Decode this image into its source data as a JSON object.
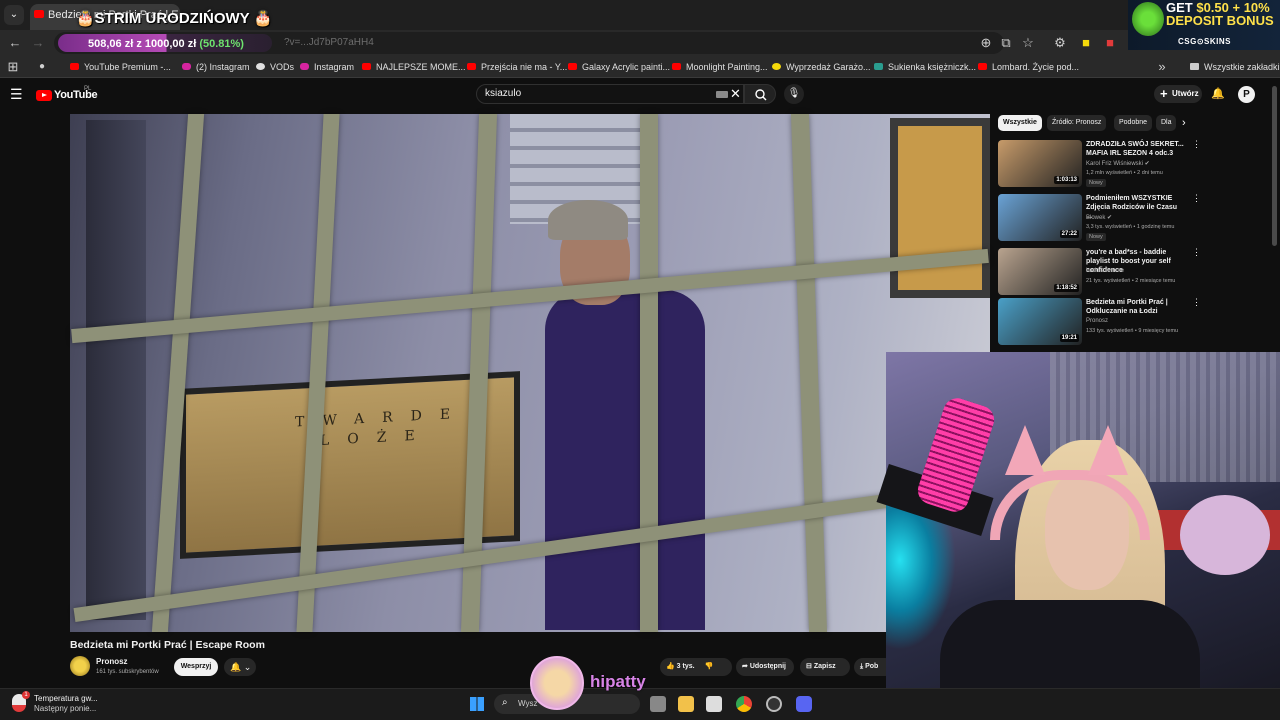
{
  "browser": {
    "tab_title": "Bedzieta mi Portki Prać | E...",
    "url_fragment": "?v=...Jd7bP07aHH4",
    "bookmarks": [
      {
        "label": "YouTube Premium -...",
        "icon": "youtube"
      },
      {
        "label": "(2) Instagram",
        "icon": "instagram"
      },
      {
        "label": "VODs",
        "icon": "globe"
      },
      {
        "label": "Instagram",
        "icon": "instagram"
      },
      {
        "label": "NAJLEPSZE MOME...",
        "icon": "youtube"
      },
      {
        "label": "Przejścia nie ma - Y...",
        "icon": "youtube"
      },
      {
        "label": "Galaxy Acrylic painti...",
        "icon": "youtube"
      },
      {
        "label": "Moonlight Painting...",
        "icon": "youtube"
      },
      {
        "label": "Wyprzedaż Garażo...",
        "icon": "yellow-dot"
      },
      {
        "label": "Sukienka księżniczk...",
        "icon": "vinted"
      },
      {
        "label": "Lombard. Życie pod...",
        "icon": "youtube"
      }
    ],
    "all_bookmarks_label": "Wszystkie zakładki"
  },
  "overlay": {
    "stream_title": "🎂STRIM URODZIŃOWY 🎂",
    "goal_current": "508,06 zł",
    "goal_sep": " z ",
    "goal_target": "1000,00 zł",
    "goal_percent": "(50.81%)",
    "goal_fraction": 0.5081,
    "streamer_name": "hipatty"
  },
  "ad": {
    "line1_a": "GET ",
    "line1_b": "$0.50 + 10%",
    "line2": "DEPOSIT BONUS",
    "brand": "CSG⊙SKINS"
  },
  "youtube": {
    "logo_text": "YouTube",
    "region": "PL",
    "search_value": "ksiazulo",
    "create_label": "Utwórz",
    "avatar_letter": "P",
    "video_title": "Bedzieta mi Portki Prać | Escape Room",
    "board_line1": "TWARDE",
    "board_line2": "LOŻE",
    "channel_name": "Pronosz",
    "channel_subs": "161 tys. subskrybentów",
    "support_label": "Wesprzyj",
    "like_count": "3 tys.",
    "share_label": "Udostępnij",
    "save_label": "Zapisz",
    "more_label": "Pob"
  },
  "sidebar": {
    "chips": [
      "Wszystkie",
      "Źródło: Pronosz",
      "Podobne",
      "Dla"
    ],
    "recommendations": [
      {
        "title": "ZDRADZIŁA SWÓJ SEKRET... MAFIA IRL SEZON 4 odc.3",
        "channel": "Karol Friz Wiśniewski ✔",
        "meta": "1,2 mln wyświetleń • 2 dni temu",
        "badge": "Nowy",
        "duration": "1:03:13",
        "thumb_color": "#c79b6a"
      },
      {
        "title": "Podmieniłem WSZYSTKIE Zdjęcia Rodziców ile Czasu ...",
        "channel": "Blowek ✔",
        "meta": "3,3 tys. wyświetleń • 1 godzinę temu",
        "badge": "Nowy",
        "duration": "27:22",
        "thumb_color": "#6aa3d6"
      },
      {
        "title": "you're a bad*ss - baddie playlist to boost your self confidence",
        "channel": "baddie femme",
        "meta": "21 tys. wyświetleń • 2 miesiące temu",
        "badge": "",
        "duration": "1:18:52",
        "thumb_color": "#b9a48f"
      },
      {
        "title": "Bedzieta mi Portki Prać | Odkluczanie na Łodzi",
        "channel": "Pronosz",
        "meta": "133 tys. wyświetleń • 9 miesięcy temu",
        "badge": "",
        "duration": "19:21",
        "thumb_color": "#4aa0c8"
      }
    ]
  },
  "taskbar": {
    "weather_title": "Temperatura gw...",
    "weather_sub": "Następny ponie...",
    "weather_badge": "1",
    "search_placeholder": "Wysz"
  }
}
